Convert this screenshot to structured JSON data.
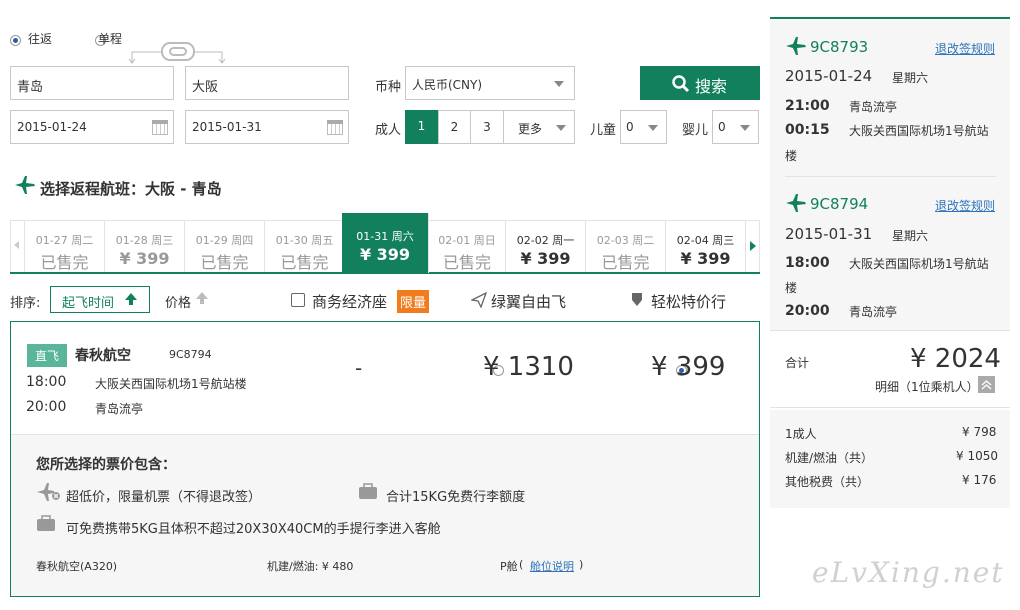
{
  "trip": {
    "round_trip_label": "往返",
    "one_way_label": "单程"
  },
  "search": {
    "from": "青岛",
    "to": "大阪",
    "depart_date": "2015-01-24",
    "return_date": "2015-01-31",
    "currency_label": "币种",
    "currency_value": "人民币(CNY)",
    "adult_label": "成人",
    "adult_options": [
      "1",
      "2",
      "3"
    ],
    "more_label": "更多",
    "child_label": "儿童",
    "child_value": "0",
    "infant_label": "婴儿",
    "infant_value": "0",
    "search_button": "搜索"
  },
  "section_title": "选择返程航班：大阪 - 青岛",
  "date_tabs": [
    {
      "date": "01-27",
      "weekday": "周二",
      "price": "已售完"
    },
    {
      "date": "01-28",
      "weekday": "周三",
      "price": "¥ 399"
    },
    {
      "date": "01-29",
      "weekday": "周四",
      "price": "已售完"
    },
    {
      "date": "01-30",
      "weekday": "周五",
      "price": "已售完"
    },
    {
      "date": "01-31",
      "weekday": "周六",
      "price": "¥ 399"
    },
    {
      "date": "02-01",
      "weekday": "周日",
      "price": "已售完"
    },
    {
      "date": "02-02",
      "weekday": "周一",
      "price": "¥ 399"
    },
    {
      "date": "02-03",
      "weekday": "周二",
      "price": "已售完"
    },
    {
      "date": "02-04",
      "weekday": "周三",
      "price": "¥ 399"
    }
  ],
  "sort": {
    "label": "排序:",
    "departure": "起飞时间",
    "price": "价格",
    "business_economy": "商务经济座",
    "limited": "限量",
    "green_wings": "绿翼自由飞",
    "easy_special": "轻松特价行"
  },
  "flight": {
    "badge": "直飞",
    "airline": "春秋航空",
    "number": "9C8794",
    "dep_time": "18:00",
    "dep_airport": "大阪关西国际机场1号航站楼",
    "arr_time": "20:00",
    "arr_airport": "青岛流亭",
    "dash": "-",
    "price1": "¥ 1310",
    "price2": "¥ 399"
  },
  "includes": {
    "title": "您所选择的票价包含：",
    "item1": "超低价，限量机票（不得退改签）",
    "item2": "合计15KG免费行李额度",
    "item3": "可免费携带5KG且体积不超过20X30X40CM的手提行李进入客舱",
    "aircraft": "春秋航空(A320)",
    "fuel": "机建/燃油: ¥ 480",
    "cabin": "P舱",
    "cabin_link": "舱位说明",
    "cabin_close": ")"
  },
  "summary": {
    "rules_link": "退改签规则",
    "seg1": {
      "number": "9C8793",
      "date": "2015-01-24",
      "weekday": "星期六",
      "dep_time": "21:00",
      "dep_airport": "青岛流亭",
      "arr_time": "00:15",
      "arr_airport": "大阪关西国际机场1号航站",
      "arr_wrap": "楼"
    },
    "seg2": {
      "number": "9C8794",
      "date": "2015-01-31",
      "weekday": "星期六",
      "dep_time": "18:00",
      "dep_airport": "大阪关西国际机场1号航站",
      "dep_wrap": "楼",
      "arr_time": "20:00",
      "arr_airport": "青岛流亭"
    },
    "total_label": "合计",
    "total": "¥ 2024",
    "detail": "明细（1位乘机人）",
    "rows": [
      {
        "label": "1成人",
        "value": "¥ 798"
      },
      {
        "label": "机建/燃油（共）",
        "value": "¥ 1050"
      },
      {
        "label": "其他税费（共）",
        "value": "¥ 176"
      }
    ]
  },
  "watermark": "eLvXing.net",
  "colors": {
    "accent": "#12805c",
    "link": "#2d73b9",
    "limited": "#f07c1e"
  }
}
